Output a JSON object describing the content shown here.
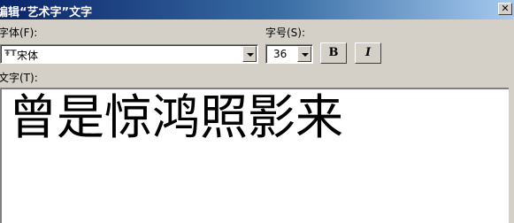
{
  "window": {
    "title": "编辑“艺术字”文字",
    "close_glyph": "✕"
  },
  "font": {
    "label": "字体(F):",
    "value": "宋体",
    "icon": "truetype-font-icon"
  },
  "size": {
    "label": "字号(S):",
    "value": "36"
  },
  "toolbar": {
    "bold_label": "B",
    "italic_label": "I"
  },
  "text": {
    "label": "文字(T):",
    "value": "曾是惊鸿照影来"
  }
}
